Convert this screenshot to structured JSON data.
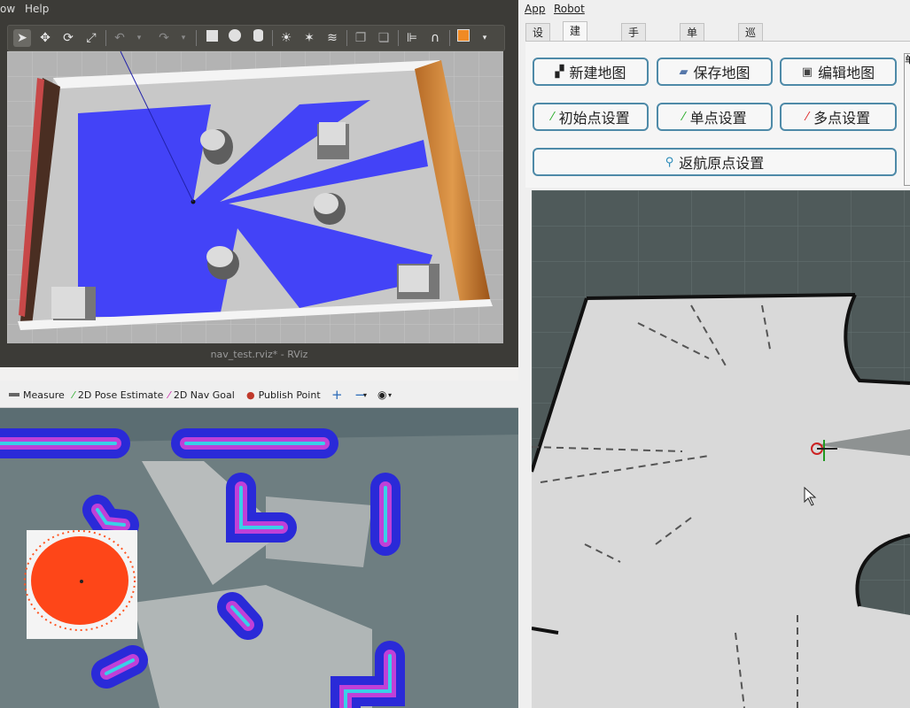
{
  "gazebo": {
    "menu": {
      "view": "ow",
      "help": "Help"
    },
    "toolbar_icons": [
      "select-arrow-icon",
      "translate-icon",
      "rotate-icon",
      "scale-icon",
      "undo-icon",
      "redo-icon",
      "box-icon",
      "sphere-icon",
      "cylinder-icon",
      "sun-light-icon",
      "spot-light-icon",
      "directional-light-icon",
      "copy-icon",
      "paste-icon",
      "align-icon",
      "magnet-icon",
      "orange-box-icon"
    ],
    "window_title": "nav_test.rviz* - RViz"
  },
  "rviz": {
    "tools": {
      "measure": "Measure",
      "pose_estimate": "2D Pose Estimate",
      "nav_goal": "2D Nav Goal",
      "publish_point": "Publish Point"
    }
  },
  "app": {
    "menu": {
      "app": "App",
      "robot": "Robot"
    },
    "tabs": [
      "设置",
      "建图导航",
      "手动控制",
      "单点模式",
      "巡航模式"
    ],
    "active_tab": 1,
    "buttons": {
      "new_map": "新建地图",
      "save_map": "保存地图",
      "edit_map": "编辑地图",
      "init_pose": "初始点设置",
      "single_point": "单点设置",
      "multi_point": "多点设置",
      "return_home": "返航原点设置"
    },
    "side_char": "单",
    "colors": {
      "button_border": "#4e8aa8",
      "laser_blue": "#2b2bff",
      "particle_red": "#ff3300"
    }
  }
}
